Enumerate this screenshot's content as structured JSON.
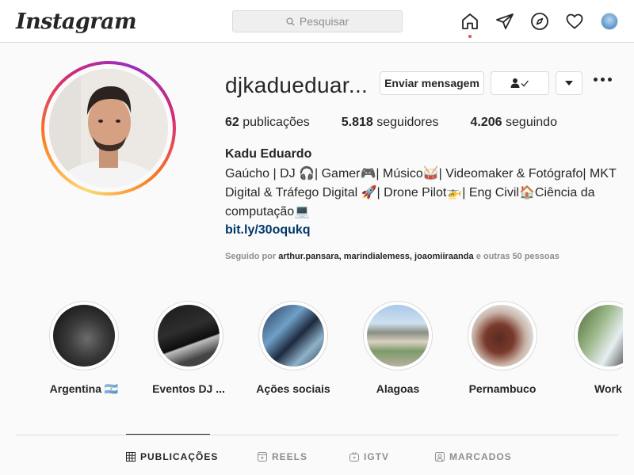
{
  "nav": {
    "logo": "Instagram",
    "search_placeholder": "Pesquisar"
  },
  "profile": {
    "username": "djkadueduar...",
    "message_button": "Enviar mensagem",
    "follow_button_symbol": "👤✓",
    "dropdown_symbol": "▾",
    "stats": {
      "posts_count": "62",
      "posts_label": "publicações",
      "followers_count": "5.818",
      "followers_label": "seguidores",
      "following_count": "4.206",
      "following_label": "seguindo"
    },
    "full_name": "Kadu Eduardo",
    "bio_line1": "Gaúcho | DJ 🎧| Gamer🎮| Músico🥁| Videomaker & Fotógrafo| MKT",
    "bio_line2": "Digital & Tráfego Digital 🚀| Drone Pilot🚁| Eng Civil🏠Ciência da",
    "bio_line3": "computação💻",
    "link": "bit.ly/30oqukq",
    "followed_by_prefix": "Seguido por",
    "followed_by_names": "arthur.pansara, marindialemess, joaomiiraanda",
    "followed_by_suffix": "e outras 50 pessoas"
  },
  "highlights": [
    {
      "label": "Argentina 🇦🇷"
    },
    {
      "label": "Eventos DJ ..."
    },
    {
      "label": "Ações sociais"
    },
    {
      "label": "Alagoas"
    },
    {
      "label": "Pernambuco"
    },
    {
      "label": "Work"
    }
  ],
  "tabs": [
    {
      "label": "PUBLICAÇÕES",
      "icon": "grid-icon",
      "active": true
    },
    {
      "label": "REELS",
      "icon": "reels-icon",
      "active": false
    },
    {
      "label": "IGTV",
      "icon": "igtv-icon",
      "active": false
    },
    {
      "label": "MARCADOS",
      "icon": "tagged-icon",
      "active": false
    }
  ],
  "colors": {
    "link": "#00376b",
    "notification_dot": "#ed4956",
    "story_ring_start": "#feda75",
    "story_ring_end": "#d62976"
  }
}
